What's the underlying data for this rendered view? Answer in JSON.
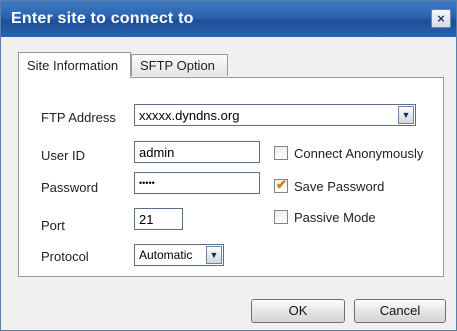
{
  "window": {
    "title": "Enter site to connect to",
    "close_symbol": "×"
  },
  "tabs": [
    {
      "label": "Site Information",
      "active": true
    },
    {
      "label": "SFTP Option",
      "active": false
    }
  ],
  "form": {
    "ftp_address": {
      "label": "FTP Address",
      "value": "xxxxx.dyndns.org"
    },
    "user_id": {
      "label": "User ID",
      "value": "admin"
    },
    "password": {
      "label": "Password",
      "value": "•••••"
    },
    "port": {
      "label": "Port",
      "value": "21"
    },
    "protocol": {
      "label": "Protocol",
      "value": "Automatic"
    }
  },
  "options": {
    "connect_anonymously": {
      "label": "Connect Anonymously",
      "checked": false
    },
    "save_password": {
      "label": "Save Password",
      "checked": true
    },
    "passive_mode": {
      "label": "Passive Mode",
      "checked": false
    }
  },
  "buttons": {
    "ok": "OK",
    "cancel": "Cancel"
  },
  "icons": {
    "dropdown": "chevron-down-icon",
    "checkmark": "✔"
  },
  "colors": {
    "titlebar": "#2b62ad",
    "check": "#d77a16"
  }
}
